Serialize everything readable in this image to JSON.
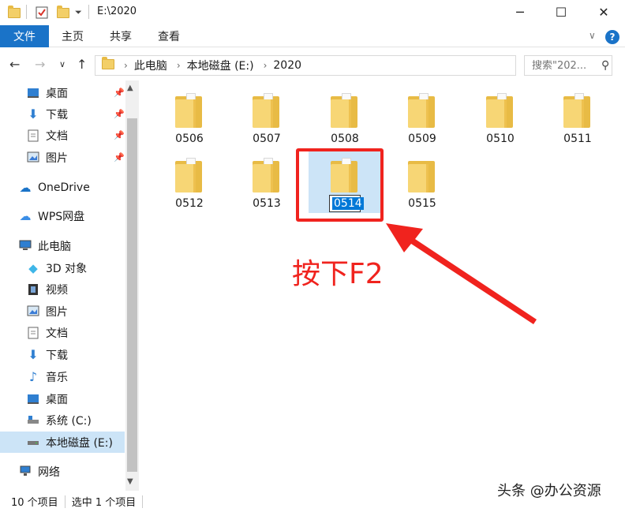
{
  "window": {
    "title": "E:\\2020",
    "minimize_glyph": "─",
    "maximize_glyph": "☐",
    "close_glyph": "✕"
  },
  "ribbon": {
    "tabs": [
      "文件",
      "主页",
      "共享",
      "查看"
    ],
    "help_glyph": "?"
  },
  "address": {
    "crumbs": [
      "此电脑",
      "本地磁盘 (E:)",
      "2020"
    ],
    "search_placeholder": "搜索\"202...",
    "back_glyph": "←",
    "forward_glyph": "→",
    "recent_glyph": "∨",
    "up_glyph": "↑"
  },
  "sidebar": {
    "items": [
      {
        "label": "桌面",
        "icon": "desktop-icon",
        "pinned": true
      },
      {
        "label": "下载",
        "icon": "download-icon",
        "pinned": true
      },
      {
        "label": "文档",
        "icon": "document-icon",
        "pinned": true
      },
      {
        "label": "图片",
        "icon": "picture-icon",
        "pinned": true
      },
      {
        "label": "OneDrive",
        "icon": "onedrive-icon"
      },
      {
        "label": "WPS网盘",
        "icon": "wps-cloud-icon"
      },
      {
        "label": "此电脑",
        "icon": "this-pc-icon"
      },
      {
        "label": "3D 对象",
        "icon": "3d-objects-icon"
      },
      {
        "label": "视频",
        "icon": "video-icon"
      },
      {
        "label": "图片",
        "icon": "picture-icon"
      },
      {
        "label": "文档",
        "icon": "document-icon"
      },
      {
        "label": "下载",
        "icon": "download-icon"
      },
      {
        "label": "音乐",
        "icon": "music-icon"
      },
      {
        "label": "桌面",
        "icon": "desktop-icon"
      },
      {
        "label": "系统 (C:)",
        "icon": "system-drive-icon"
      },
      {
        "label": "本地磁盘 (E:)",
        "icon": "local-drive-icon",
        "selected": true
      },
      {
        "label": "网络",
        "icon": "network-icon"
      }
    ]
  },
  "files": [
    {
      "name": "0506"
    },
    {
      "name": "0507"
    },
    {
      "name": "0508"
    },
    {
      "name": "0509"
    },
    {
      "name": "0510"
    },
    {
      "name": "0511"
    },
    {
      "name": "0512"
    },
    {
      "name": "0513"
    },
    {
      "name": "0514",
      "selected": true,
      "renaming": true
    },
    {
      "name": "0515",
      "empty": true
    }
  ],
  "annotation": {
    "text": "按下F2",
    "color": "#f0231e"
  },
  "status": {
    "count": "10 个项目",
    "selection": "选中 1 个项目"
  },
  "watermark": "头条 @办公资源",
  "colors": {
    "accent": "#1a73c8",
    "selection": "#cce4f7",
    "folder": "#f7d675"
  }
}
